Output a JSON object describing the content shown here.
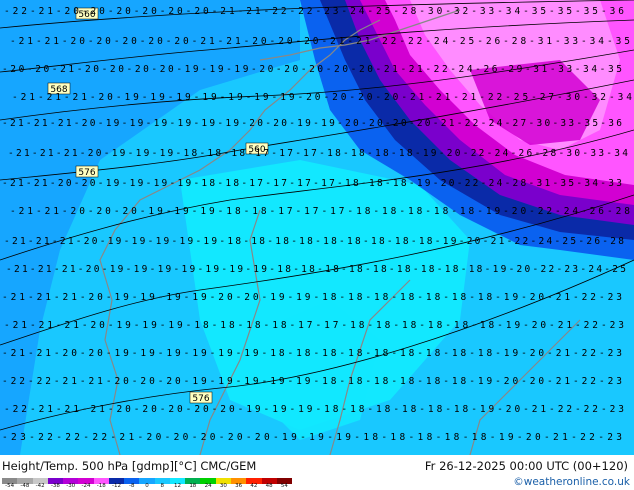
{
  "map": {
    "height_labels": [
      "560",
      "568",
      "560",
      "576",
      "576"
    ],
    "colors": {
      "water": "#6aa0e6",
      "light_cyan": "#12e8ff",
      "cyan": "#19c8ff",
      "sky": "#16a6ff",
      "blue": "#0a62f0",
      "deep_blue": "#0a2aa8",
      "violet": "#7a00cc",
      "magenta": "#d200d2",
      "pink": "#ff55ff",
      "light_pink": "#ff8cff",
      "contour": "#000000",
      "coast": "#888888"
    },
    "temperature_labels": {
      "row1": "-22-21-20-20-20-20-20-20-21-21-22-22-23-24-25-28-30-32-33-34-35-35-35-36",
      "row2": "-21-21-20-20-20-20-20-21-21-20-20-20-21-21-22-22-24-25-26-28-31-33-34-35",
      "row3": "-20-20-21-20-20-20-20-19-19-19-20-20-20-20-20-21-21-22-24-26-29-31-33-34-35",
      "row4": "-21-21-21-20-19-19-19-19-19-19-19-20-20-20-20-21-21-21-22-25-27-30-32-34",
      "row5": "-21-21-21-20-19-19-19-19-19-19-20-20-19-19-20-20-20-20-21-22-24-27-30-33-35-36",
      "row6": "-21-21-21-20-19-19-19-18-18-18-17-17-17-18-18-18-18-19-20-22-24-26-28-30-33-34",
      "row7": "-21-21-20-20-19-19-19-19-18-18-17-17-17-17-18-18-18-19-20-22-24-28-31-35-34-33",
      "row8": "-21-21-20-20-20-19-19-19-18-18-17-17-17-18-18-18-18-18-19-20-22-24-26-28",
      "row9": "-21-21-21-20-19-19-19-19-19-18-18-18-18-18-18-18-18-18-19-20-21-22-24-25-26-28",
      "row10": "-21-21-21-20-19-19-19-19-19-19-19-18-18-18-18-18-18-18-18-18-19-20-22-23-24-25",
      "row11": "-21-21-21-20-19-19-19-19-20-20-19-19-18-18-18-18-18-18-18-19-20-21-22-23",
      "row12": "-21-21-21-20-19-19-19-18-18-18-18-17-17-18-18-18-18-18-18-19-20-21-22-23",
      "row13": "-21-21-20-20-19-19-19-19-19-19-18-18-18-18-18-18-18-18-18-19-20-21-22-23",
      "row14": "-22-22-21-21-20-20-20-19-19-19-19-19-18-18-18-18-18-18-19-20-20-21-22-23",
      "row15": "-22-21-21-21-20-20-20-20-20-19-19-19-18-18-18-18-18-18-19-20-21-22-22-23",
      "row16": "-23-22-22-22-21-20-20-20-20-20-19-19-19-18-18-18-18-18-19-20-21-22-23"
    }
  },
  "footer": {
    "title": "Height/Temp. 500 hPa [gdmp][°C] CMC/GEM",
    "datetime": "Fr 26-12-2025 00:00 UTC (00+120)",
    "credit": "©weatheronline.co.uk",
    "legend": {
      "ticks": [
        "-54",
        "-48",
        "-42",
        "-38",
        "-30",
        "-24",
        "-18",
        "-12",
        "-8",
        "0",
        "8",
        "12",
        "18",
        "24",
        "30",
        "36",
        "42",
        "48",
        "54"
      ],
      "colors": [
        "#8a8a8a",
        "#a8a8a8",
        "#c8c8c8",
        "#7a00cc",
        "#b400d8",
        "#d200d2",
        "#ff55ff",
        "#0a2aa8",
        "#0a62f0",
        "#16a6ff",
        "#19c8ff",
        "#12e8ff",
        "#00b050",
        "#00d000",
        "#f0e000",
        "#ff9000",
        "#ff2000",
        "#c00000",
        "#800000"
      ]
    }
  }
}
